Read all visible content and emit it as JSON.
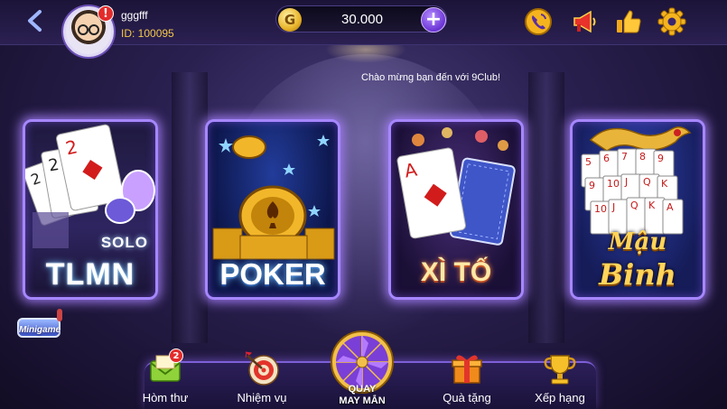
{
  "header": {
    "username": "gggfff",
    "user_id": "ID: 100095",
    "alert_badge": "!",
    "coin_symbol": "G",
    "coin_amount": "30.000",
    "add_label": "+"
  },
  "icons": {
    "back": "back-arrow-icon",
    "support": "phone-support-icon",
    "announce": "megaphone-icon",
    "like": "thumbs-up-icon",
    "settings": "gear-icon"
  },
  "welcome_text": "Chào mừng bạn đến với 9Club!",
  "games": [
    {
      "id": "tlmn",
      "subtitle": "SOLO",
      "title": "TLMN"
    },
    {
      "id": "poker",
      "title": "POKER"
    },
    {
      "id": "xito",
      "title": "XÌ TỐ"
    },
    {
      "id": "maubinh",
      "title_line1": "Mậu",
      "title_line2": "Binh"
    }
  ],
  "minigame_label": "Minigame",
  "nav": {
    "mail": {
      "label": "Hòm thư",
      "badge": "2"
    },
    "missions": {
      "label": "Nhiệm vụ"
    },
    "lucky_spin": {
      "label_line1": "QUAY",
      "label_line2": "MAY MẮN"
    },
    "gifts": {
      "label": "Quà tặng"
    },
    "ranking": {
      "label": "Xếp hạng"
    }
  },
  "colors": {
    "card_glow": "#a687ff",
    "coin_gold": "#e8b328",
    "id_gold": "#f3c84a",
    "badge_red": "#e32b2b"
  }
}
